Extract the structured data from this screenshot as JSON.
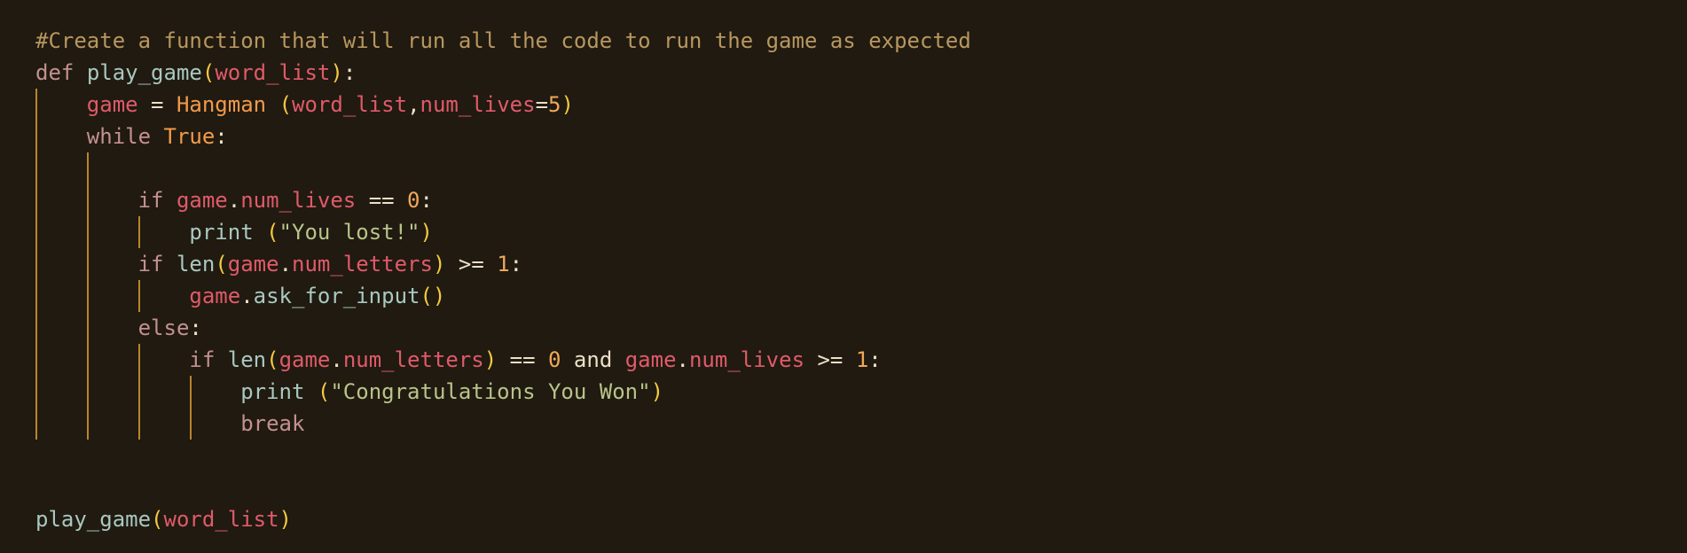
{
  "editor": {
    "theme_colors": {
      "background": "#201a10",
      "comment": "#b8975f",
      "keyword": "#c49090",
      "function": "#a9c8c0",
      "variable": "#e05a6a",
      "class": "#f29a4a",
      "number": "#f0a85a",
      "bracket": "#f5c842",
      "string": "#b8c48a",
      "indent_guide": "#b8862b"
    },
    "lines": [
      [
        {
          "t": "#Create a function that will run all the code to run the game as expected",
          "c": "comment"
        }
      ],
      [
        {
          "t": "def",
          "c": "kw"
        },
        {
          "t": " ",
          "c": "plain"
        },
        {
          "t": "play_game",
          "c": "fn"
        },
        {
          "t": "(",
          "c": "brk"
        },
        {
          "t": "word_list",
          "c": "var"
        },
        {
          "t": ")",
          "c": "brk"
        },
        {
          "t": ":",
          "c": "plain"
        }
      ],
      [
        {
          "t": "    ",
          "c": "plain"
        },
        {
          "t": "game",
          "c": "var"
        },
        {
          "t": " = ",
          "c": "op"
        },
        {
          "t": "Hangman",
          "c": "cls"
        },
        {
          "t": " ",
          "c": "plain"
        },
        {
          "t": "(",
          "c": "brk"
        },
        {
          "t": "word_list",
          "c": "var"
        },
        {
          "t": ",",
          "c": "plain"
        },
        {
          "t": "num_lives",
          "c": "var"
        },
        {
          "t": "=",
          "c": "op"
        },
        {
          "t": "5",
          "c": "num"
        },
        {
          "t": ")",
          "c": "brk"
        }
      ],
      [
        {
          "t": "    ",
          "c": "plain"
        },
        {
          "t": "while",
          "c": "kw"
        },
        {
          "t": " ",
          "c": "plain"
        },
        {
          "t": "True",
          "c": "cls"
        },
        {
          "t": ":",
          "c": "plain"
        }
      ],
      [],
      [
        {
          "t": "        ",
          "c": "plain"
        },
        {
          "t": "if",
          "c": "kw"
        },
        {
          "t": " ",
          "c": "plain"
        },
        {
          "t": "game",
          "c": "var"
        },
        {
          "t": ".",
          "c": "plain"
        },
        {
          "t": "num_lives",
          "c": "var"
        },
        {
          "t": " == ",
          "c": "op"
        },
        {
          "t": "0",
          "c": "num"
        },
        {
          "t": ":",
          "c": "plain"
        }
      ],
      [
        {
          "t": "            ",
          "c": "plain"
        },
        {
          "t": "print",
          "c": "fn"
        },
        {
          "t": " ",
          "c": "plain"
        },
        {
          "t": "(",
          "c": "brk"
        },
        {
          "t": "\"You lost!\"",
          "c": "str"
        },
        {
          "t": ")",
          "c": "brk"
        }
      ],
      [
        {
          "t": "        ",
          "c": "plain"
        },
        {
          "t": "if",
          "c": "kw"
        },
        {
          "t": " ",
          "c": "plain"
        },
        {
          "t": "len",
          "c": "fn"
        },
        {
          "t": "(",
          "c": "brk"
        },
        {
          "t": "game",
          "c": "var"
        },
        {
          "t": ".",
          "c": "plain"
        },
        {
          "t": "num_letters",
          "c": "var"
        },
        {
          "t": ")",
          "c": "brk"
        },
        {
          "t": " >= ",
          "c": "op"
        },
        {
          "t": "1",
          "c": "num"
        },
        {
          "t": ":",
          "c": "plain"
        }
      ],
      [
        {
          "t": "            ",
          "c": "plain"
        },
        {
          "t": "game",
          "c": "var"
        },
        {
          "t": ".",
          "c": "plain"
        },
        {
          "t": "ask_for_input",
          "c": "fn"
        },
        {
          "t": "()",
          "c": "brk"
        }
      ],
      [
        {
          "t": "        ",
          "c": "plain"
        },
        {
          "t": "else",
          "c": "kw"
        },
        {
          "t": ":",
          "c": "plain"
        }
      ],
      [
        {
          "t": "            ",
          "c": "plain"
        },
        {
          "t": "if",
          "c": "kw"
        },
        {
          "t": " ",
          "c": "plain"
        },
        {
          "t": "len",
          "c": "fn"
        },
        {
          "t": "(",
          "c": "brk"
        },
        {
          "t": "game",
          "c": "var"
        },
        {
          "t": ".",
          "c": "plain"
        },
        {
          "t": "num_letters",
          "c": "var"
        },
        {
          "t": ")",
          "c": "brk"
        },
        {
          "t": " == ",
          "c": "op"
        },
        {
          "t": "0",
          "c": "num"
        },
        {
          "t": " and ",
          "c": "op"
        },
        {
          "t": "game",
          "c": "var"
        },
        {
          "t": ".",
          "c": "plain"
        },
        {
          "t": "num_lives",
          "c": "var"
        },
        {
          "t": " >= ",
          "c": "op"
        },
        {
          "t": "1",
          "c": "num"
        },
        {
          "t": ":",
          "c": "plain"
        }
      ],
      [
        {
          "t": "                ",
          "c": "plain"
        },
        {
          "t": "print",
          "c": "fn"
        },
        {
          "t": " ",
          "c": "plain"
        },
        {
          "t": "(",
          "c": "brk"
        },
        {
          "t": "\"Congratulations You Won\"",
          "c": "str"
        },
        {
          "t": ")",
          "c": "brk"
        }
      ],
      [
        {
          "t": "                ",
          "c": "plain"
        },
        {
          "t": "break",
          "c": "kw"
        }
      ],
      [],
      [],
      [
        {
          "t": "play_game",
          "c": "fn"
        },
        {
          "t": "(",
          "c": "brk"
        },
        {
          "t": "word_list",
          "c": "var"
        },
        {
          "t": ")",
          "c": "brk"
        }
      ]
    ]
  }
}
